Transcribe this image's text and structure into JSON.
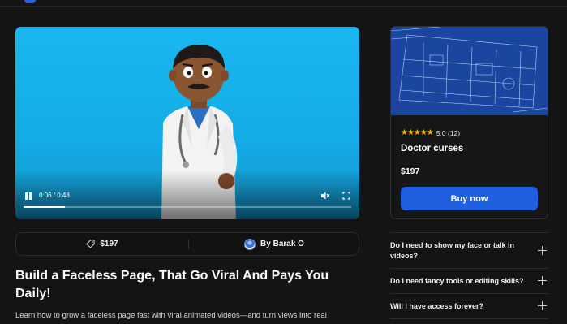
{
  "video": {
    "current_time": "0:06",
    "duration": "0:48",
    "time_display": "0:06 / 0:48",
    "progress_fraction": 0.125
  },
  "infobar": {
    "price": "$197",
    "author": "By Barak O"
  },
  "page": {
    "title": "Build a Faceless Page, That Go Viral And Pays You Daily!",
    "description": "Learn how to grow a faceless page fast with viral animated videos—and turn views into real"
  },
  "product_card": {
    "rating_text": "5.0 (12)",
    "stars": "★★★★★",
    "title": "Doctor curses",
    "price": "$197",
    "buy_label": "Buy now"
  },
  "faq": [
    {
      "question": "Do I need to show my face or talk in videos?"
    },
    {
      "question": "Do I need fancy tools or editing skills?"
    },
    {
      "question": "Will I have access forever?"
    }
  ],
  "colors": {
    "accent": "#1f5fe0",
    "star": "#f5b800",
    "background": "#141414"
  }
}
